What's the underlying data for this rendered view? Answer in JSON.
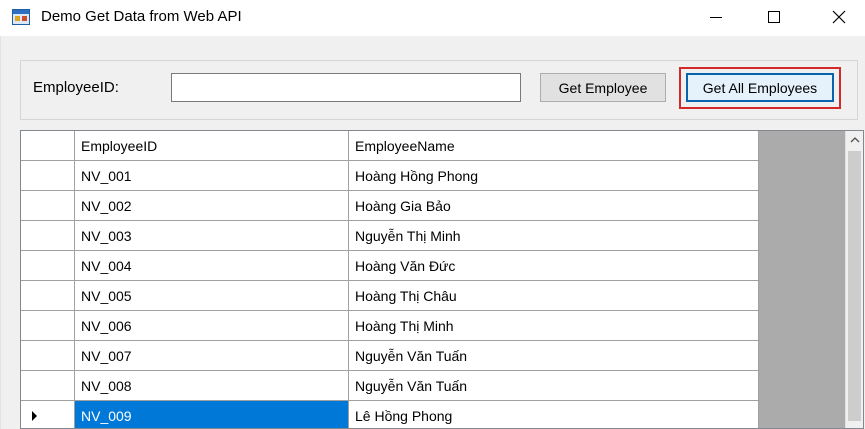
{
  "window": {
    "title": "Demo Get Data from Web API",
    "minimize_glyph": "—",
    "maximize_glyph": "☐",
    "close_glyph": "✕"
  },
  "form": {
    "employee_id_label": "EmployeeID:",
    "employee_id_value": "",
    "get_employee_label": "Get Employee",
    "get_all_employees_label": "Get All Employees"
  },
  "grid": {
    "columns": [
      "EmployeeID",
      "EmployeeName"
    ],
    "rows": [
      {
        "id": "NV_001",
        "name": "Hoàng Hồng Phong"
      },
      {
        "id": "NV_002",
        "name": "Hoàng Gia Bảo"
      },
      {
        "id": "NV_003",
        "name": "Nguyễn Thị Minh"
      },
      {
        "id": "NV_004",
        "name": "Hoàng Văn Đức"
      },
      {
        "id": "NV_005",
        "name": "Hoàng Thị Châu"
      },
      {
        "id": "NV_006",
        "name": "Hoàng Thị Minh"
      },
      {
        "id": "NV_007",
        "name": "Nguyễn Văn Tuấn"
      },
      {
        "id": "NV_008",
        "name": "Nguyễn Văn Tuấn"
      },
      {
        "id": "NV_009",
        "name": "Lê Hồng Phong"
      }
    ],
    "selected_row_index": 8
  },
  "colors": {
    "selection": "#0078d7",
    "highlight_border": "#d02a2a",
    "grid_background": "#ababab"
  },
  "icons": {
    "app": "window-form-icon",
    "minimize": "minimize-icon",
    "maximize": "maximize-icon",
    "close": "close-icon",
    "row_pointer": "row-pointer-icon",
    "scroll_up": "chevron-up-icon"
  }
}
